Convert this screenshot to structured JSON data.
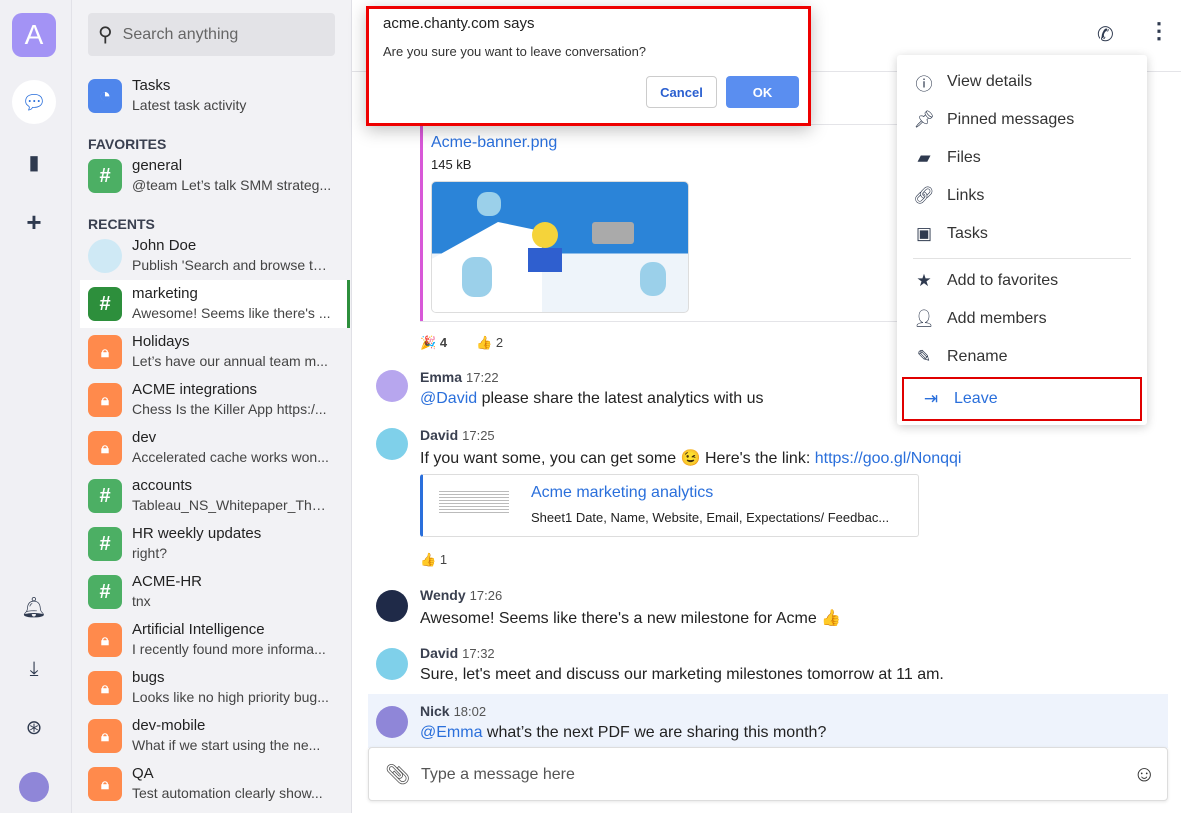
{
  "rail": {
    "workspace_initial": "A",
    "icons": [
      "chat-icon",
      "contacts-icon",
      "plus-icon",
      "bell-icon",
      "download-icon",
      "help-icon"
    ]
  },
  "search": {
    "placeholder": "Search anything"
  },
  "sidebar": {
    "tasks": {
      "title": "Tasks",
      "subtitle": "Latest task activity"
    },
    "favorites_label": "FAVORITES",
    "favorites": [
      {
        "title": "general",
        "subtitle": "@team Let’s talk SMM strateg...",
        "type": "public"
      }
    ],
    "recents_label": "RECENTS",
    "recents": [
      {
        "title": "John Doe",
        "subtitle": "Publish 'Search and browse ta...",
        "type": "user"
      },
      {
        "title": "marketing",
        "subtitle": "Awesome! Seems like there's ...",
        "type": "public",
        "active": true
      },
      {
        "title": "Holidays",
        "subtitle": "Let’s have our annual team m...",
        "type": "private"
      },
      {
        "title": "ACME integrations",
        "subtitle": "Chess Is the Killer App https:/...",
        "type": "private"
      },
      {
        "title": "dev",
        "subtitle": "Accelerated cache works won...",
        "type": "private"
      },
      {
        "title": "accounts",
        "subtitle": "Tableau_NS_Whitepaper_The_...",
        "type": "public"
      },
      {
        "title": "HR weekly updates",
        "subtitle": "right?",
        "type": "public"
      },
      {
        "title": "ACME-HR",
        "subtitle": "tnx",
        "type": "public"
      },
      {
        "title": "Artificial Intelligence",
        "subtitle": "I recently found more informa...",
        "type": "private"
      },
      {
        "title": "bugs",
        "subtitle": "Looks like no high priority bug...",
        "type": "private"
      },
      {
        "title": "dev-mobile",
        "subtitle": "What if we start using the ne...",
        "type": "private"
      },
      {
        "title": "QA",
        "subtitle": "Test automation clearly show...",
        "type": "private"
      }
    ]
  },
  "dialog": {
    "title": "acme.chanty.com says",
    "message": "Are you sure you want to leave conversation?",
    "cancel": "Cancel",
    "ok": "OK"
  },
  "menu": {
    "items": [
      "View details",
      "Pinned messages",
      "Files",
      "Links",
      "Tasks",
      "Add to favorites",
      "Add members",
      "Rename",
      "Leave"
    ]
  },
  "attachment": {
    "name": "Acme-banner.png",
    "size": "145 kB",
    "reactions": [
      {
        "emoji": "🎉",
        "count": "4"
      },
      {
        "emoji": "👍",
        "count": "2"
      }
    ]
  },
  "messages": [
    {
      "author": "Emma",
      "time": "17:22",
      "mention": "@David",
      "text": " please share the latest analytics with us"
    },
    {
      "author": "David",
      "time": "17:25",
      "text": "If you want some, you can get some 😉 Here's the link: ",
      "link": "https://goo.gl/Nonqqi",
      "preview": {
        "title": "Acme marketing analytics",
        "desc": "Sheet1 Date, Name, Website, Email, Expectations/ Feedbac..."
      },
      "reactions": [
        {
          "emoji": "👍",
          "count": "1"
        }
      ]
    },
    {
      "author": "Wendy",
      "time": "17:26",
      "text": "Awesome! Seems like there's a new milestone for Acme 👍"
    },
    {
      "author": "David",
      "time": "17:32",
      "text": "Sure, let's meet and discuss our marketing milestones tomorrow at 11 am."
    },
    {
      "author": "Nick",
      "time": "18:02",
      "mention": "@Emma",
      "text": " what’s the next PDF we are sharing this month?"
    }
  ],
  "composer": {
    "placeholder": "Type a message here"
  },
  "colors": {
    "accent": "#2a6fdb",
    "public": "#4caf64",
    "active_public": "#2d8f3c",
    "private": "#ff8a4c",
    "tasks": "#4f86ec",
    "highlight": "#e00000"
  }
}
